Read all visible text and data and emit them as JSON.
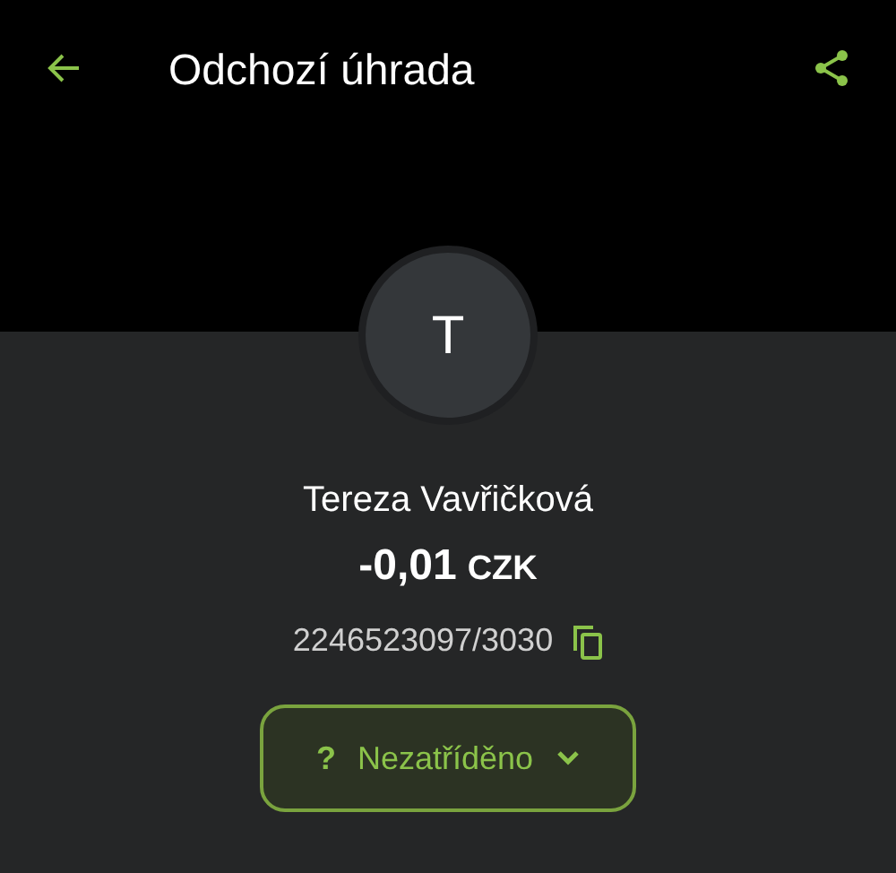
{
  "header": {
    "title": "Odchozí úhrada"
  },
  "counterparty": {
    "initial": "T",
    "name": "Tereza Vavřičková",
    "amount": "-0,01",
    "currency": "CZK",
    "account": "2246523097/3030"
  },
  "category": {
    "symbol": "?",
    "label": "Nezatříděno"
  }
}
